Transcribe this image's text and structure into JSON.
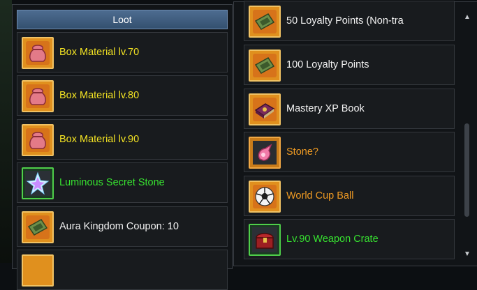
{
  "colors": {
    "loot_header": "#3f5c80",
    "yellow_text": "#f3e323",
    "green_text": "#37e230",
    "white_text": "#f2f2f2",
    "orange_text": "#ee9a23"
  },
  "loot": {
    "title": "Loot",
    "items": [
      {
        "name": "Box Material lv.70",
        "icon": "loot-bag-icon",
        "rarity": "yellow"
      },
      {
        "name": "Box Material lv.80",
        "icon": "loot-bag-icon",
        "rarity": "yellow"
      },
      {
        "name": "Box Material lv.90",
        "icon": "loot-bag-icon",
        "rarity": "yellow"
      },
      {
        "name": "Luminous Secret Stone",
        "icon": "star-stone-icon",
        "rarity": "green"
      },
      {
        "name": "Aura Kingdom Coupon: 10",
        "icon": "coupon-icon",
        "rarity": "white"
      }
    ]
  },
  "rewards": {
    "items": [
      {
        "name": "50 Loyalty Points (Non-tra",
        "icon": "coupon-icon",
        "rarity": "white"
      },
      {
        "name": "100 Loyalty Points",
        "icon": "coupon-icon",
        "rarity": "white"
      },
      {
        "name": "Mastery XP Book",
        "icon": "book-icon",
        "rarity": "white"
      },
      {
        "name": "Stone?",
        "icon": "pink-stone-icon",
        "rarity": "orange"
      },
      {
        "name": "World Cup Ball",
        "icon": "soccer-ball-icon",
        "rarity": "orange"
      },
      {
        "name": "Lv.90 Weapon Crate",
        "icon": "treasure-chest-icon",
        "rarity": "green"
      }
    ]
  }
}
